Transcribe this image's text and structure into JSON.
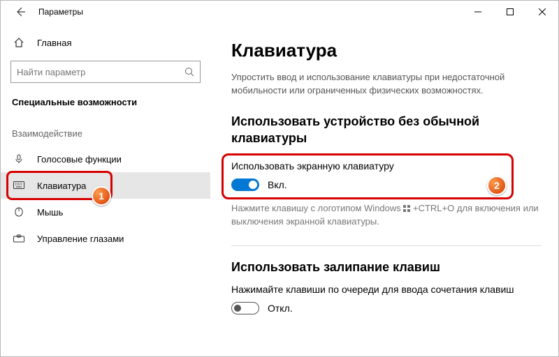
{
  "titlebar": {
    "app_title": "Параметры"
  },
  "sidebar": {
    "home_label": "Главная",
    "search_placeholder": "Найти параметр",
    "section_header": "Специальные возможности",
    "group_label": "Взаимодействие",
    "items": [
      {
        "label": "Голосовые функции"
      },
      {
        "label": "Клавиатура"
      },
      {
        "label": "Мышь"
      },
      {
        "label": "Управление глазами"
      }
    ]
  },
  "main": {
    "heading": "Клавиатура",
    "description": "Упростить ввод и использование клавиатуры при недостаточной мобильности или ограниченных физических возможностях.",
    "section1": {
      "heading": "Использовать устройство без обычной клавиатуры",
      "setting_label": "Использовать экранную клавиатуру",
      "toggle_state": "Вкл.",
      "help_pre": "Нажмите клавишу с логотипом Windows ",
      "help_post": " +CTRL+O для включения или выключения экранной клавиатуры."
    },
    "section2": {
      "heading": "Использовать залипание клавиш",
      "setting_label": "Нажимайте клавиши по очереди для ввода сочетания клавиш",
      "toggle_state": "Откл."
    }
  },
  "annotations": {
    "badge1": "1",
    "badge2": "2"
  }
}
